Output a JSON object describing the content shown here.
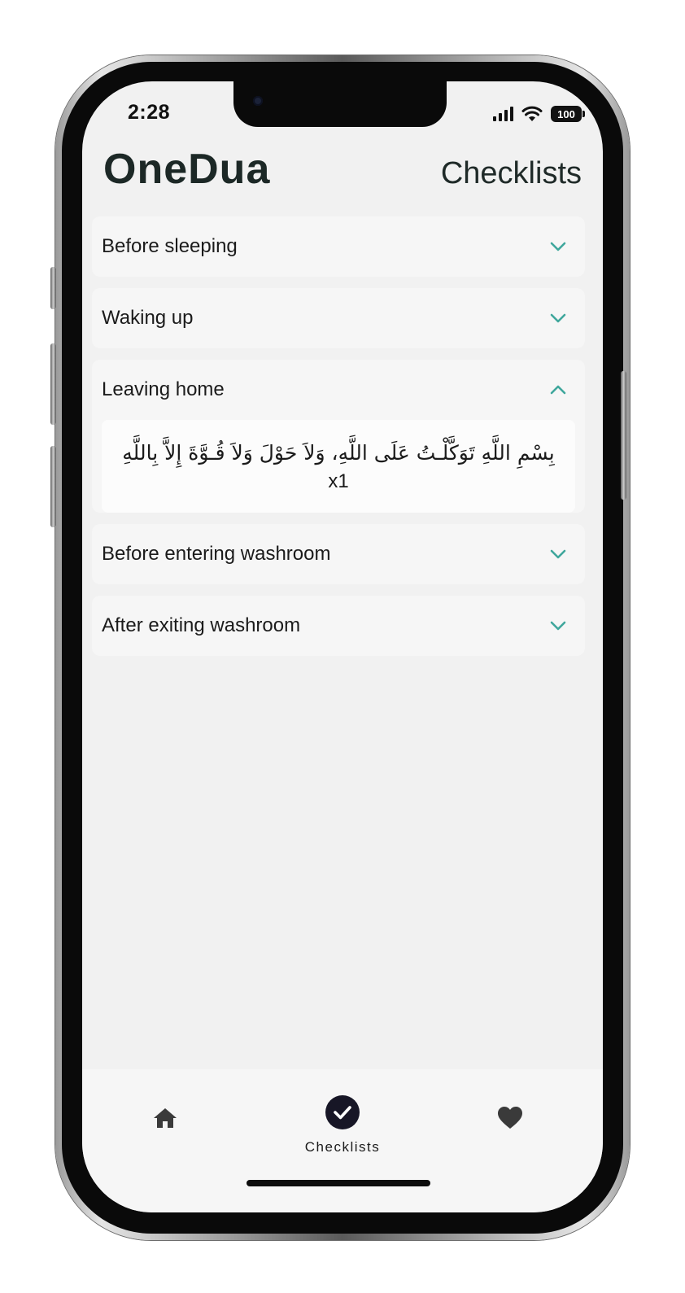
{
  "status_bar": {
    "time": "2:28",
    "battery": "100"
  },
  "header": {
    "app_title": "OneDua",
    "page_title": "Checklists"
  },
  "checklist": {
    "items": [
      {
        "label": "Before sleeping",
        "expanded": false,
        "icon": "chevron-down-icon"
      },
      {
        "label": "Waking up",
        "expanded": false,
        "icon": "chevron-down-icon"
      },
      {
        "label": "Leaving home",
        "expanded": true,
        "icon": "chevron-up-icon",
        "dua": "بِسْمِ اللَّهِ تَوَكَّلْـتُ عَلَى اللَّهِ، وَلاَ حَوْلَ وَلاَ قُـوَّةَ إِلاَّ بِاللَّهِ",
        "count": "x1"
      },
      {
        "label": "Before entering washroom",
        "expanded": false,
        "icon": "chevron-down-icon"
      },
      {
        "label": "After exiting washroom",
        "expanded": false,
        "icon": "chevron-down-icon"
      }
    ]
  },
  "tabbar": {
    "tabs": [
      {
        "icon": "home-icon",
        "label": ""
      },
      {
        "icon": "check-circle-icon",
        "label": "Checklists",
        "active": true
      },
      {
        "icon": "heart-icon",
        "label": ""
      }
    ]
  },
  "colors": {
    "accent": "#3fa79c",
    "screen_bg": "#f1f1f1",
    "card_bg": "#f6f6f6",
    "active_tab": "#171626"
  }
}
